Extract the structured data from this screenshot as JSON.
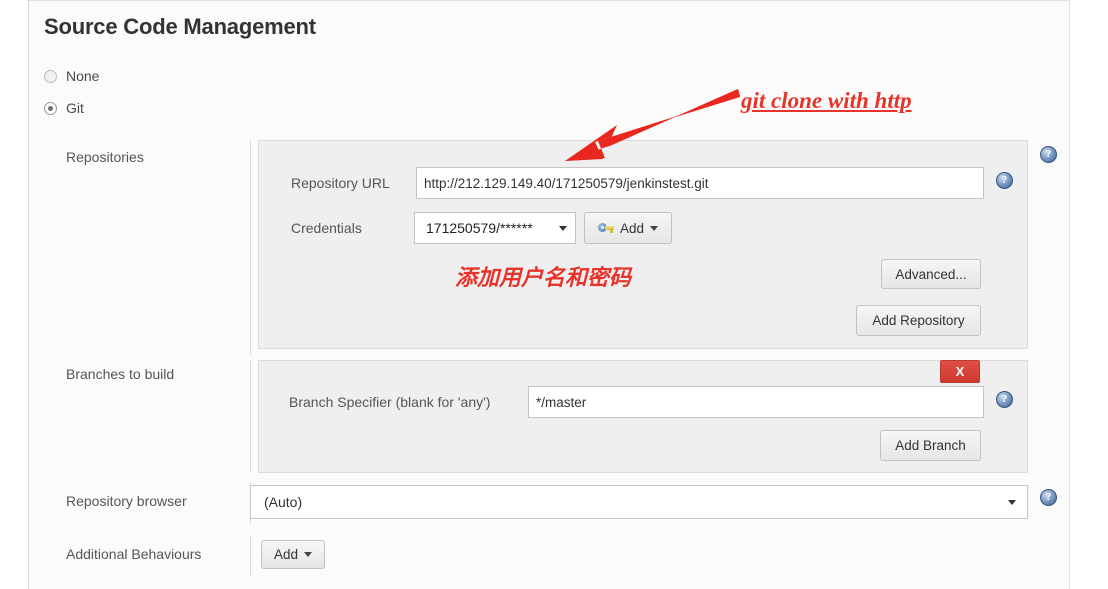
{
  "section": {
    "title": "Source Code Management"
  },
  "scm_options": [
    {
      "label": "None",
      "selected": false
    },
    {
      "label": "Git",
      "selected": true
    }
  ],
  "rows": {
    "repositories_label": "Repositories",
    "branches_label": "Branches to build",
    "repo_browser_label": "Repository browser",
    "additional_behaviours_label": "Additional Behaviours"
  },
  "repository": {
    "url_label": "Repository URL",
    "url_value": "http://212.129.149.40/171250579/jenkinstest.git",
    "credentials_label": "Credentials",
    "credentials_value": "171250579/******",
    "add_credential_label": "Add",
    "add_credential_icon": "key-icon",
    "advanced_label": "Advanced...",
    "add_repository_label": "Add Repository"
  },
  "branches": {
    "specifier_label": "Branch Specifier (blank for 'any')",
    "specifier_value": "*/master",
    "add_branch_label": "Add Branch",
    "delete_label": "X"
  },
  "repo_browser": {
    "selected": "(Auto)"
  },
  "additional_behaviours": {
    "add_label": "Add"
  },
  "help": {
    "glyph": "?"
  },
  "annotations": {
    "git_clone": "git clone with http",
    "credentials_note": "添加用户名和密码",
    "arrow_color": "#e8281f"
  },
  "colors": {
    "accent_red": "#e8332a",
    "delete_red": "#cf3a31",
    "help_blue": "#3f5f8f",
    "panel_bg": "#efefef",
    "page_bg": "#fbfbfb"
  }
}
